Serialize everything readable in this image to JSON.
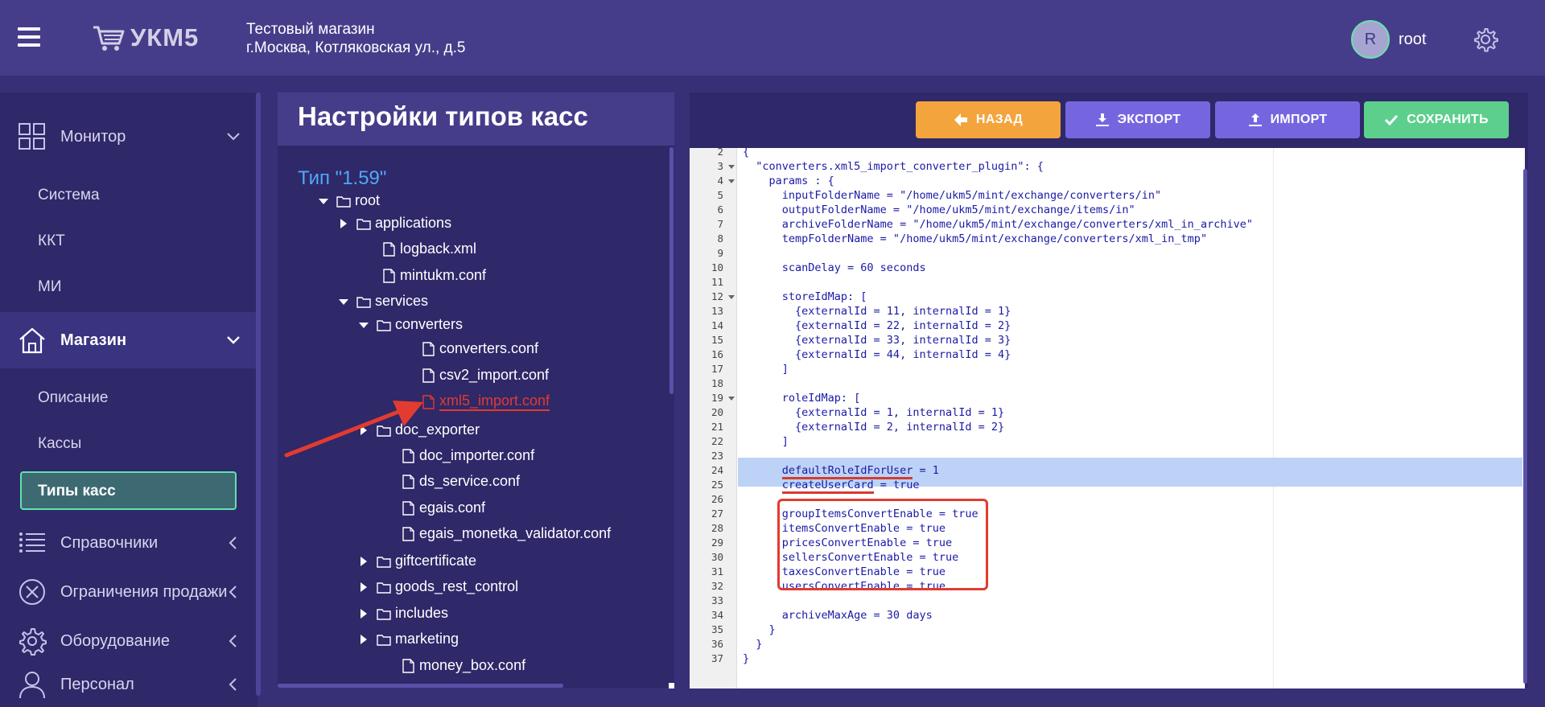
{
  "header": {
    "logo_text": "УКМ5",
    "store_name": "Тестовый магазин",
    "store_address": "г.Москва, Котляковская ул., д.5",
    "avatar_letter": "R",
    "username": "root"
  },
  "sidebar": {
    "sections": [
      {
        "label": "Монитор",
        "icon": "grid-icon"
      },
      {
        "label": "Магазин",
        "icon": "home-icon"
      },
      {
        "label": "Справочники",
        "icon": "list-icon"
      },
      {
        "label": "Ограничения продажи",
        "icon": "circle-x-icon"
      },
      {
        "label": "Оборудование",
        "icon": "gear-icon"
      },
      {
        "label": "Персонал",
        "icon": "user-icon"
      }
    ],
    "monitor_items": [
      "Система",
      "ККТ",
      "МИ"
    ],
    "store_items": [
      "Описание",
      "Кассы",
      "Типы касс"
    ]
  },
  "tree": {
    "title": "Настройки типов касс",
    "type_label": "Тип \"1.59\"",
    "nodes": [
      "root",
      "applications",
      "logback.xml",
      "mintukm.conf",
      "services",
      "converters",
      "converters.conf",
      "csv2_import.conf",
      "xml5_import.conf",
      "doc_exporter",
      "doc_importer.conf",
      "ds_service.conf",
      "egais.conf",
      "egais_monetka_validator.conf",
      "giftcertificate",
      "goods_rest_control",
      "includes",
      "marketing",
      "money_box.conf"
    ]
  },
  "toolbar": {
    "back": "НАЗАД",
    "export": "ЭКСПОРТ",
    "import": "ИМПОРТ",
    "save": "СОХРАНИТЬ"
  },
  "editor": {
    "lines": [
      {
        "n": "2",
        "text": "{"
      },
      {
        "n": "3",
        "text": "  \"converters.xml5_import_converter_plugin\": {"
      },
      {
        "n": "4",
        "text": "    params : {"
      },
      {
        "n": "5",
        "text": "      inputFolderName = \"/home/ukm5/mint/exchange/converters/in\""
      },
      {
        "n": "6",
        "text": "      outputFolderName = \"/home/ukm5/mint/exchange/items/in\""
      },
      {
        "n": "7",
        "text": "      archiveFolderName = \"/home/ukm5/mint/exchange/converters/xml_in_archive\""
      },
      {
        "n": "8",
        "text": "      tempFolderName = \"/home/ukm5/mint/exchange/converters/xml_in_tmp\""
      },
      {
        "n": "9",
        "text": ""
      },
      {
        "n": "10",
        "text": "      scanDelay = 60 seconds"
      },
      {
        "n": "11",
        "text": ""
      },
      {
        "n": "12",
        "text": "      storeIdMap: ["
      },
      {
        "n": "13",
        "text": "        {externalId = 11, internalId = 1}"
      },
      {
        "n": "14",
        "text": "        {externalId = 22, internalId = 2}"
      },
      {
        "n": "15",
        "text": "        {externalId = 33, internalId = 3}"
      },
      {
        "n": "16",
        "text": "        {externalId = 44, internalId = 4}"
      },
      {
        "n": "17",
        "text": "      ]"
      },
      {
        "n": "18",
        "text": ""
      },
      {
        "n": "19",
        "text": "      roleIdMap: ["
      },
      {
        "n": "20",
        "text": "        {externalId = 1, internalId = 1}"
      },
      {
        "n": "21",
        "text": "        {externalId = 2, internalId = 2}"
      },
      {
        "n": "22",
        "text": "      ]"
      },
      {
        "n": "23",
        "text": ""
      },
      {
        "n": "24",
        "text": "      defaultRoleIdForUser = 1"
      },
      {
        "n": "25",
        "text": "      createUserCard = true"
      },
      {
        "n": "26",
        "text": ""
      },
      {
        "n": "27",
        "text": "      groupItemsConvertEnable = true"
      },
      {
        "n": "28",
        "text": "      itemsConvertEnable = true"
      },
      {
        "n": "29",
        "text": "      pricesConvertEnable = true"
      },
      {
        "n": "30",
        "text": "      sellersConvertEnable = true"
      },
      {
        "n": "31",
        "text": "      taxesConvertEnable = true"
      },
      {
        "n": "32",
        "text": "      usersConvertEnable = true"
      },
      {
        "n": "33",
        "text": ""
      },
      {
        "n": "34",
        "text": "      archiveMaxAge = 30 days"
      },
      {
        "n": "35",
        "text": "    }"
      },
      {
        "n": "36",
        "text": "  }"
      },
      {
        "n": "37",
        "text": "}"
      }
    ]
  },
  "colors": {
    "accent_green": "#5fe3ac",
    "back_button": "#f4a43c",
    "export_button": "#7566e0",
    "save_button": "#5dcf8c",
    "highlight_red": "#e23b30"
  }
}
